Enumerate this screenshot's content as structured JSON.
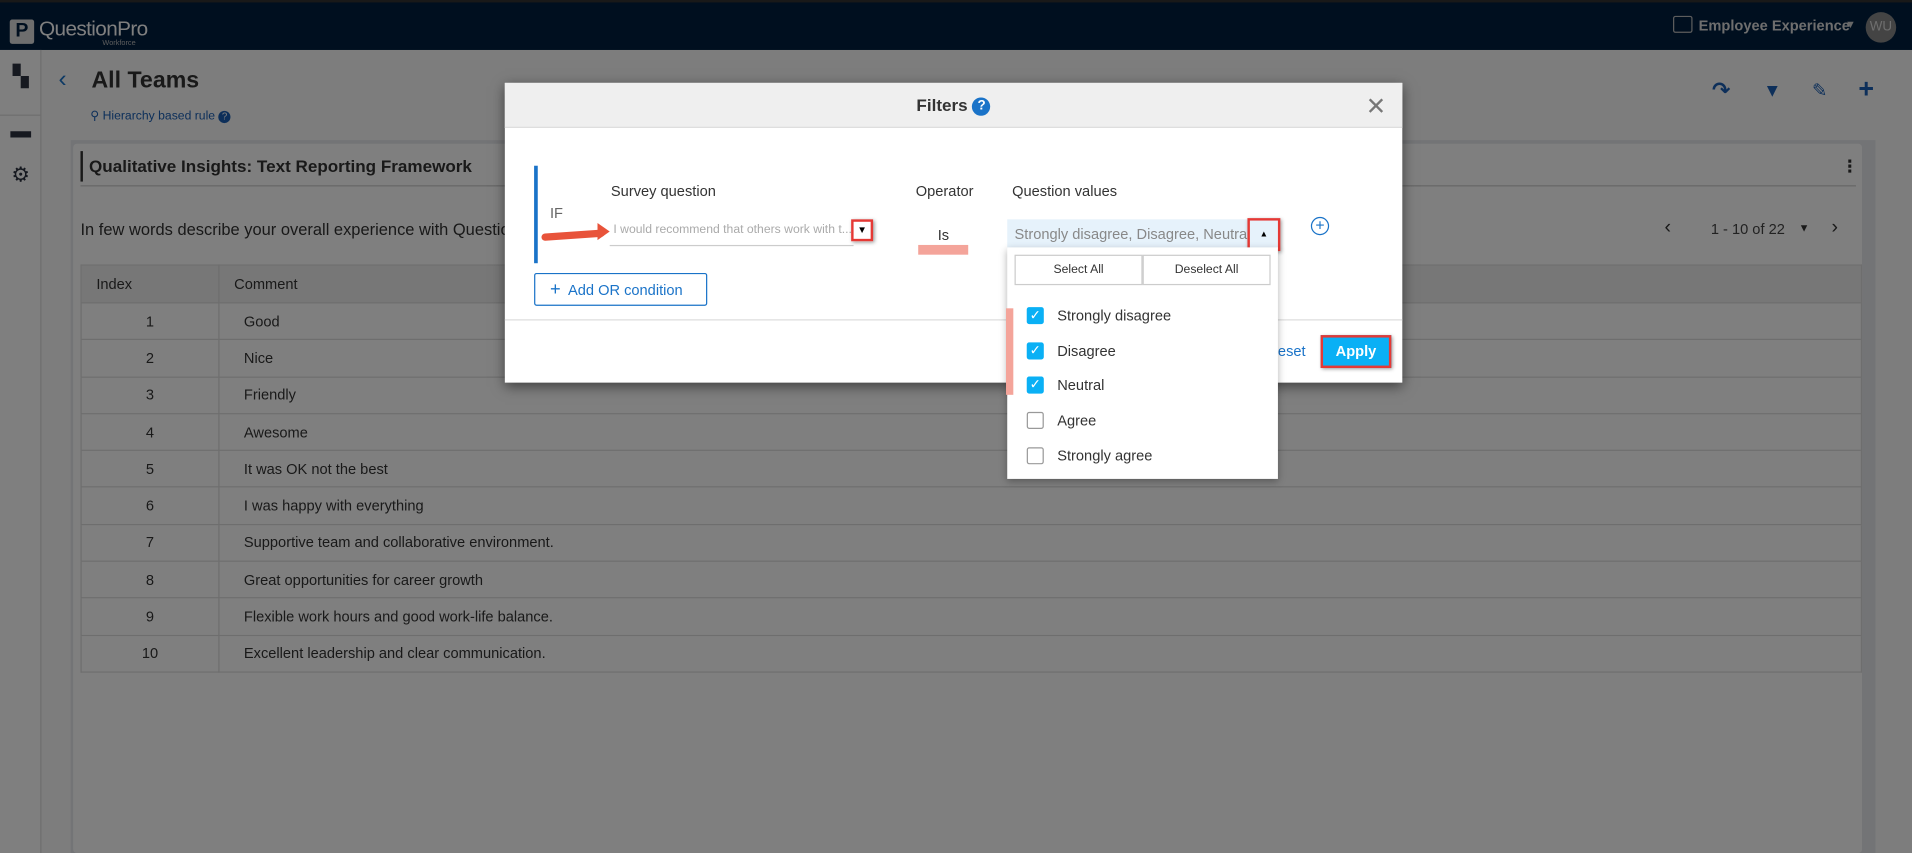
{
  "header": {
    "brand": "QuestionPro",
    "brand_sub": "Workforce",
    "product": "Employee Experience",
    "avatar": "WU"
  },
  "sidebar": {
    "icons": [
      "dashboard-icon",
      "folder-icon",
      "gear-icon"
    ]
  },
  "page": {
    "title": "All Teams",
    "rule": "Hierarchy based rule"
  },
  "card": {
    "title": "Qualitative Insights: Text Reporting Framework",
    "question": "In few words describe your overall experience with Questio",
    "pagination": "1 - 10 of 22"
  },
  "table": {
    "headers": [
      "Index",
      "Comment"
    ],
    "rows": [
      [
        "1",
        "Good"
      ],
      [
        "2",
        "Nice"
      ],
      [
        "3",
        "Friendly"
      ],
      [
        "4",
        "Awesome"
      ],
      [
        "5",
        "It was OK not the best"
      ],
      [
        "6",
        "I was happy with everything"
      ],
      [
        "7",
        "Supportive team and collaborative environment."
      ],
      [
        "8",
        "Great opportunities for career growth"
      ],
      [
        "9",
        "Flexible work hours and good work-life balance."
      ],
      [
        "10",
        "Excellent leadership and clear communication."
      ]
    ]
  },
  "modal": {
    "title": "Filters",
    "if_label": "IF",
    "survey_question_label": "Survey question",
    "survey_question_value": "I would recommend that others work with t...",
    "operator_label": "Operator",
    "operator_value": "Is",
    "question_values_label": "Question values",
    "question_values_value": "Strongly disagree, Disagree, Neutral",
    "add_or": "Add OR condition",
    "reset": "eset",
    "apply": "Apply",
    "dropdown": {
      "select_all": "Select All",
      "deselect_all": "Deselect All",
      "options": [
        {
          "label": "Strongly disagree",
          "checked": true
        },
        {
          "label": "Disagree",
          "checked": true
        },
        {
          "label": "Neutral",
          "checked": true
        },
        {
          "label": "Agree",
          "checked": false
        },
        {
          "label": "Strongly agree",
          "checked": false
        }
      ]
    }
  },
  "colors": {
    "navy": "#001f3f",
    "accent": "#1a73c8",
    "apply": "#0ab0f5",
    "highlight": "#e53935"
  }
}
